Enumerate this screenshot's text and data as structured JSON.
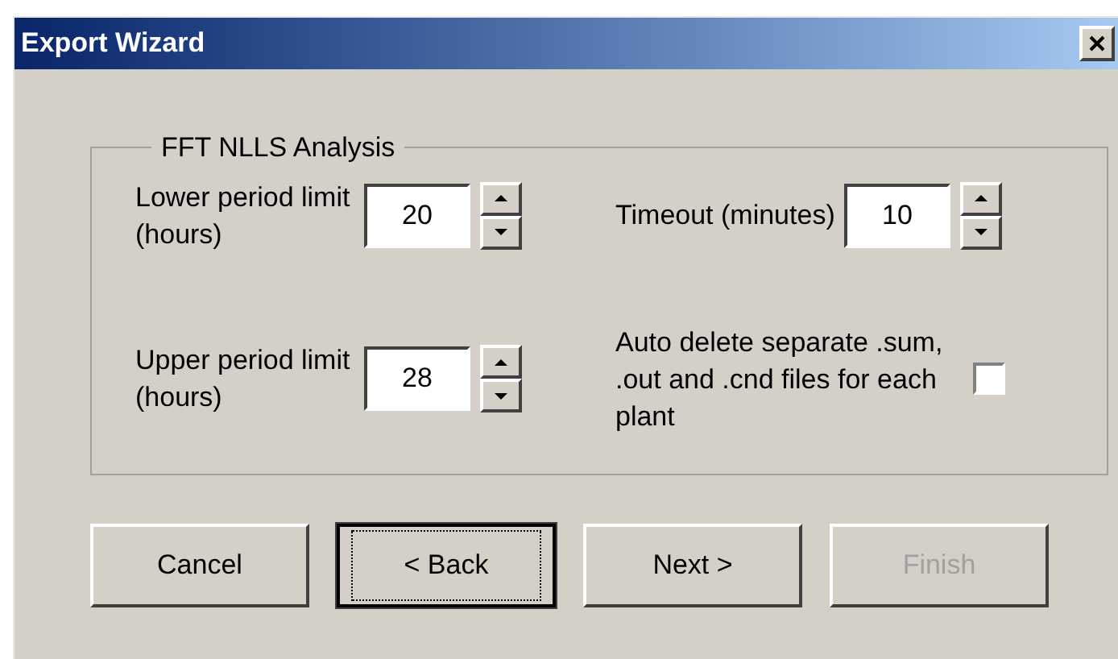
{
  "window": {
    "title": "Export Wizard"
  },
  "group": {
    "title": "FFT NLLS Analysis",
    "fields": [
      {
        "kind": "spinner",
        "label": "Lower period limit (hours)",
        "value": "20"
      },
      {
        "kind": "spinner",
        "label": "Timeout (minutes)",
        "value": "10"
      },
      {
        "kind": "spinner",
        "label": "Upper period limit (hours)",
        "value": "28"
      },
      {
        "kind": "checkbox",
        "label": "Auto delete separate .sum, .out and .cnd files for each plant",
        "checked": false
      }
    ]
  },
  "buttons": [
    {
      "label": "Cancel",
      "disabled": false,
      "focused": false
    },
    {
      "label": "< Back",
      "disabled": false,
      "focused": true
    },
    {
      "label": "Next >",
      "disabled": false,
      "focused": false
    },
    {
      "label": "Finish",
      "disabled": true,
      "focused": false
    }
  ]
}
